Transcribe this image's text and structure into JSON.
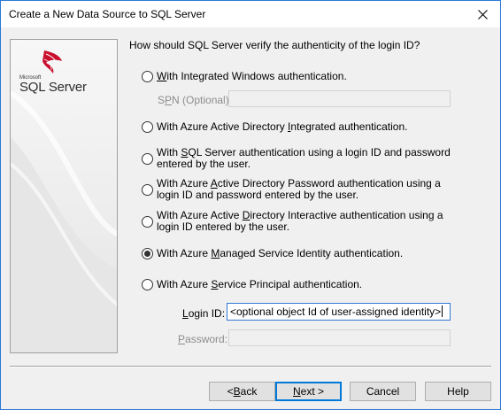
{
  "window": {
    "title": "Create a New Data Source to SQL Server",
    "close_icon": "close-icon"
  },
  "logo": {
    "small_text": "Microsoft",
    "product": "SQL Server"
  },
  "question": "How should SQL Server verify the authenticity of the login ID?",
  "options": [
    {
      "pre": "",
      "key": "W",
      "post": "ith Integrated Windows authentication.",
      "checked": false
    },
    {
      "pre": "With Azure Active Directory ",
      "key": "I",
      "post": "ntegrated authentication.",
      "checked": false
    },
    {
      "pre": "With ",
      "key": "S",
      "post": "QL Server authentication using a login ID and password entered by the user.",
      "checked": false
    },
    {
      "pre": "With Azure ",
      "key": "A",
      "post": "ctive Directory Password authentication using a login ID and password entered by the user.",
      "checked": false
    },
    {
      "pre": "With Azure Active ",
      "key": "D",
      "post": "irectory Interactive authentication using a login ID entered by the user.",
      "checked": false
    },
    {
      "pre": "With Azure ",
      "key": "M",
      "post": "anaged Service Identity authentication.",
      "checked": true
    },
    {
      "pre": "With Azure ",
      "key": "S",
      "post": "ervice Principal authentication.",
      "checked": false
    }
  ],
  "spn": {
    "label_pre": "S",
    "label_key": "P",
    "label_post": "N (Optional):",
    "value": ""
  },
  "login": {
    "label_pre": "",
    "label_key": "L",
    "label_post": "ogin ID:",
    "value": "<optional object Id of user-assigned identity>"
  },
  "password": {
    "label_pre": "",
    "label_key": "P",
    "label_post": "assword:",
    "value": ""
  },
  "buttons": {
    "back": {
      "pre": "< ",
      "key": "B",
      "post": "ack"
    },
    "next": {
      "pre": "",
      "key": "N",
      "post": "ext >"
    },
    "cancel": "Cancel",
    "help": "Help"
  },
  "colors": {
    "accent": "#0078d7",
    "sql_red": "#c8102e"
  }
}
